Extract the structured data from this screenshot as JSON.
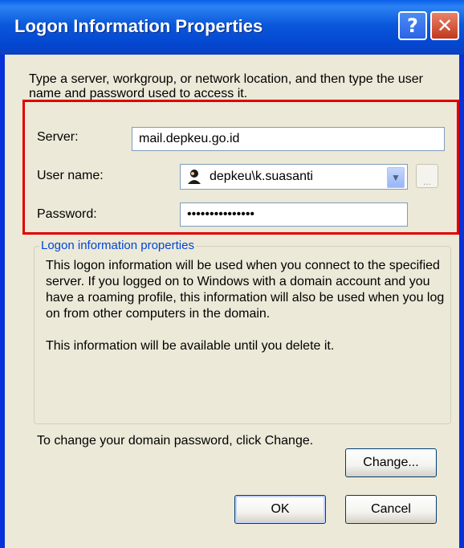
{
  "window": {
    "title": "Logon Information Properties",
    "help_glyph": "?",
    "close_glyph": "✕"
  },
  "intro_text": "Type a server, workgroup, or network location, and then type the user name and password used to access it.",
  "fields": {
    "server_label": "Server:",
    "server_value": "mail.depkeu.go.id",
    "username_label": "User name:",
    "username_value": "depkeu\\k.suasanti",
    "password_label": "Password:",
    "password_value": "•••••••••••••••",
    "browse_label": "..."
  },
  "group": {
    "legend": "Logon information properties",
    "paragraph1": "This logon information will be used when you connect to the specified server. If you logged on to Windows with a domain account and you have a roaming profile, this information will also be used when you log on from other computers in the domain.",
    "paragraph2": "This information will be available until you delete it."
  },
  "change_text": "To change your domain password, click Change.",
  "buttons": {
    "change": "Change...",
    "ok": "OK",
    "cancel": "Cancel"
  },
  "colors": {
    "highlight_border": "#e00000",
    "titlebar_blue": "#0a58dc",
    "legend_blue": "#0046d5"
  },
  "icons": {
    "help": "help-icon",
    "close": "close-icon",
    "user": "user-account-icon",
    "dropdown": "chevron-down-icon"
  }
}
